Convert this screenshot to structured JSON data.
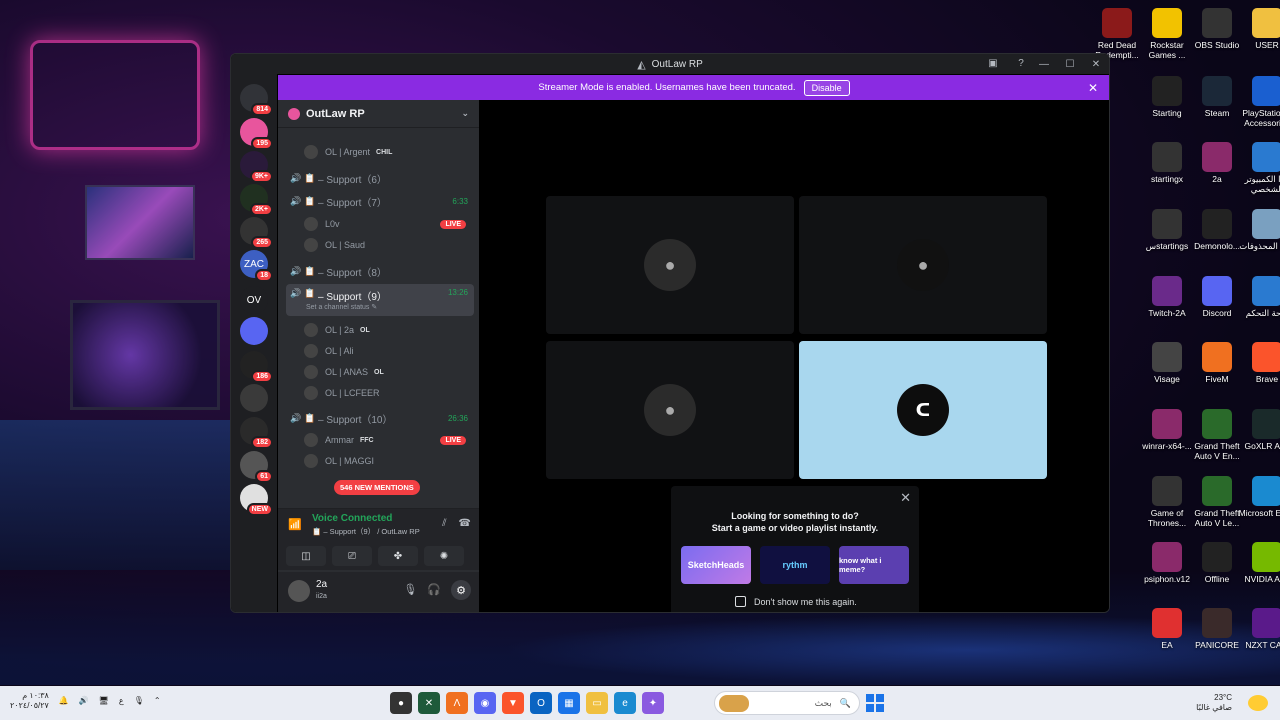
{
  "window": {
    "title": "OutLaw RP",
    "controls": {
      "minimize": "—",
      "maximize": "☐",
      "close": "✕"
    }
  },
  "banner": {
    "text": "Streamer Mode is enabled. Usernames have been truncated.",
    "button": "Disable",
    "close": "✕"
  },
  "guilds": [
    {
      "label": "",
      "badge": "814",
      "color": "#313338"
    },
    {
      "label": "",
      "badge": "195",
      "color": "#e8559d"
    },
    {
      "label": "",
      "badge": "9K+",
      "color": "#2a1a3a"
    },
    {
      "label": "",
      "badge": "2K+",
      "color": "#203020"
    },
    {
      "label": "",
      "badge": "265",
      "color": "#333"
    },
    {
      "label": "ZAC",
      "badge": "18",
      "color": "#3d5fc2"
    },
    {
      "label": "OV",
      "badge": "",
      "color": "#1e1f22"
    },
    {
      "label": "",
      "badge": "",
      "color": "#5865f2"
    },
    {
      "label": "",
      "badge": "186",
      "color": "#222"
    },
    {
      "label": "",
      "badge": "",
      "color": "#3a3a3a"
    },
    {
      "label": "",
      "badge": "182",
      "color": "#2a2a2a"
    },
    {
      "label": "",
      "badge": "61",
      "color": "#555"
    },
    {
      "label": "",
      "badge": "NEW",
      "color": "#e0e0e0"
    }
  ],
  "server": {
    "name": "OutLaw RP"
  },
  "channels": [
    {
      "kind": "user",
      "name": "OL | Argent",
      "tag": "CHIL"
    },
    {
      "kind": "channel",
      "name": "Support（6）",
      "time": "",
      "on": false
    },
    {
      "kind": "channel",
      "name": "Support（7）",
      "time": "6:33",
      "on": true
    },
    {
      "kind": "user",
      "name": "L0v",
      "tag": "",
      "live": "LIVE"
    },
    {
      "kind": "user",
      "name": "OL | Saud",
      "tag": ""
    },
    {
      "kind": "channel",
      "name": "Support（8）",
      "time": "",
      "on": false
    },
    {
      "kind": "channel",
      "name": "Support（9）",
      "time": "13:26",
      "on": true,
      "active": true,
      "status": "Set a channel status"
    },
    {
      "kind": "user",
      "name": "OL | 2a",
      "tag": "OL"
    },
    {
      "kind": "user",
      "name": "OL | Ali",
      "tag": ""
    },
    {
      "kind": "user",
      "name": "OL | ANAS",
      "tag": "OL"
    },
    {
      "kind": "user",
      "name": "OL | LCFEER",
      "tag": ""
    },
    {
      "kind": "channel",
      "name": "Support（10）",
      "time": "26:36",
      "on": true
    },
    {
      "kind": "user",
      "name": "Ammar",
      "tag": "FFC",
      "live": "LIVE"
    },
    {
      "kind": "user",
      "name": "OL | MAGGI",
      "tag": ""
    }
  ],
  "new_mentions": "546 NEW MENTIONS",
  "voice": {
    "title": "Voice Connected",
    "subtitle": "📋 – Support（9） / OutLaw RP"
  },
  "user_panel": {
    "name": "2a",
    "sub": "ii2a"
  },
  "activity": {
    "line1": "Looking for something to do?",
    "line2": "Start a game or video playlist instantly.",
    "cards": [
      "SketchHeads",
      "rythm",
      "know what i meme?"
    ],
    "checkbox_label": "Don't show me this again."
  },
  "desktop_icons": [
    {
      "label": "Red Dead Redempti...",
      "color": "#8b1a1a"
    },
    {
      "label": "Rockstar Games ...",
      "color": "#f2c200"
    },
    {
      "label": "OBS Studio",
      "color": "#333"
    },
    {
      "label": "USER",
      "color": "#f0c040"
    },
    {
      "label": "Starting",
      "color": "#222"
    },
    {
      "label": "Steam",
      "color": "#1b2838"
    },
    {
      "label": "PlayStation® Accessories",
      "color": "#1a5fd0"
    },
    {
      "label": "startingx",
      "color": "#333"
    },
    {
      "label": "2a",
      "color": "#8a2a6a"
    },
    {
      "label": "هذا الكمبيوتر الشخصي",
      "color": "#2a7ad0"
    },
    {
      "label": "سstartings",
      "color": "#333"
    },
    {
      "label": "Demonolo...",
      "color": "#222"
    },
    {
      "label": "سلة المحذوفات",
      "color": "#7aa0c0"
    },
    {
      "label": "Twitch-2A",
      "color": "#6a2a8a"
    },
    {
      "label": "Discord",
      "color": "#5865f2"
    },
    {
      "label": "لوحة التحكم",
      "color": "#2a7ad0"
    },
    {
      "label": "Visage",
      "color": "#444"
    },
    {
      "label": "FiveM",
      "color": "#f07020"
    },
    {
      "label": "Brave",
      "color": "#fb542b"
    },
    {
      "label": "winrar-x64-...",
      "color": "#8a2a6a"
    },
    {
      "label": "Grand Theft Auto V En...",
      "color": "#2a6a2a"
    },
    {
      "label": "GoXLR App",
      "color": "#1a2a2a"
    },
    {
      "label": "Game of Thrones...",
      "color": "#333"
    },
    {
      "label": "Grand Theft Auto V Le...",
      "color": "#2a6a2a"
    },
    {
      "label": "Microsoft Edge",
      "color": "#1a8ad0"
    },
    {
      "label": "psiphon.v12",
      "color": "#8a2a6a"
    },
    {
      "label": "Offline",
      "color": "#222"
    },
    {
      "label": "NVIDIA App",
      "color": "#76b900"
    },
    {
      "label": "EA",
      "color": "#e03030"
    },
    {
      "label": "PANICORE",
      "color": "#3a2a2a"
    },
    {
      "label": "NZXT CAM",
      "color": "#5a1a8a"
    }
  ],
  "taskbar": {
    "search_placeholder": "بحث",
    "clock_time": "١٠:٣٨ م",
    "clock_date": "٢٠٢٤/٠٥/٢٧",
    "lang": "ع",
    "weather_temp": "23°C",
    "weather_text": "صافي غالبًا"
  }
}
